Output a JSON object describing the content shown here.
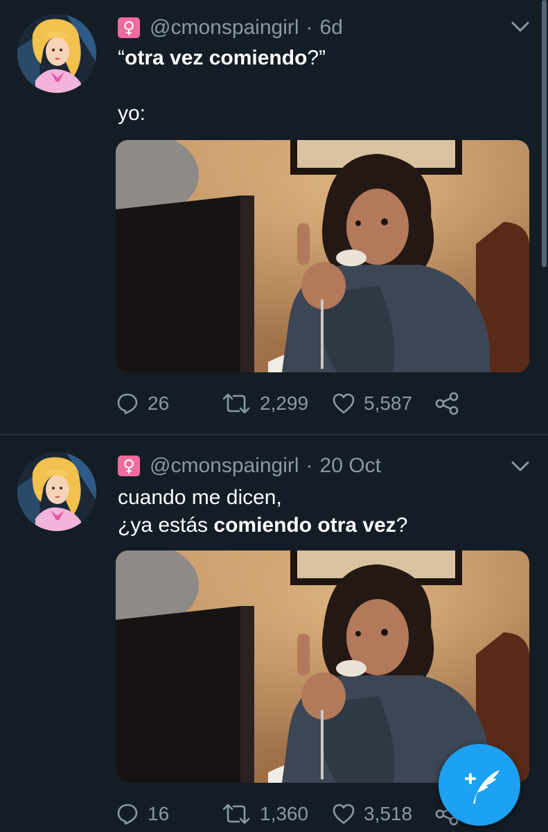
{
  "tweets": [
    {
      "handle": "@cmonspaingirl",
      "separator": "·",
      "time": "6d",
      "badge_glyph": "♀",
      "text_lines": [
        [
          {
            "text": "“",
            "bold": false
          },
          {
            "text": "otra vez comiendo",
            "bold": true
          },
          {
            "text": "?”",
            "bold": false
          }
        ],
        [],
        [
          {
            "text": "yo:",
            "bold": false
          }
        ]
      ],
      "replies": "26",
      "retweets": "2,299",
      "likes": "5,587"
    },
    {
      "handle": "@cmonspaingirl",
      "separator": "·",
      "time": "20 Oct",
      "badge_glyph": "♀",
      "text_lines": [
        [
          {
            "text": "cuando me dicen,",
            "bold": false
          }
        ],
        [
          {
            "text": "¿ya estás ",
            "bold": false
          },
          {
            "text": "comiendo otra vez",
            "bold": true
          },
          {
            "text": "?",
            "bold": false
          }
        ]
      ],
      "replies": "16",
      "retweets": "1,360",
      "likes": "3,518"
    }
  ],
  "icons": {
    "badge": "female-sign-icon",
    "caret": "chevron-down-icon",
    "reply": "reply-icon",
    "retweet": "retweet-icon",
    "like": "heart-icon",
    "share": "share-icon",
    "compose": "compose-tweet-icon"
  },
  "colors": {
    "background": "#141d26",
    "divider": "#263340",
    "muted_text": "#8899a6",
    "accent": "#1da1f2",
    "badge": "#f16ba0"
  }
}
